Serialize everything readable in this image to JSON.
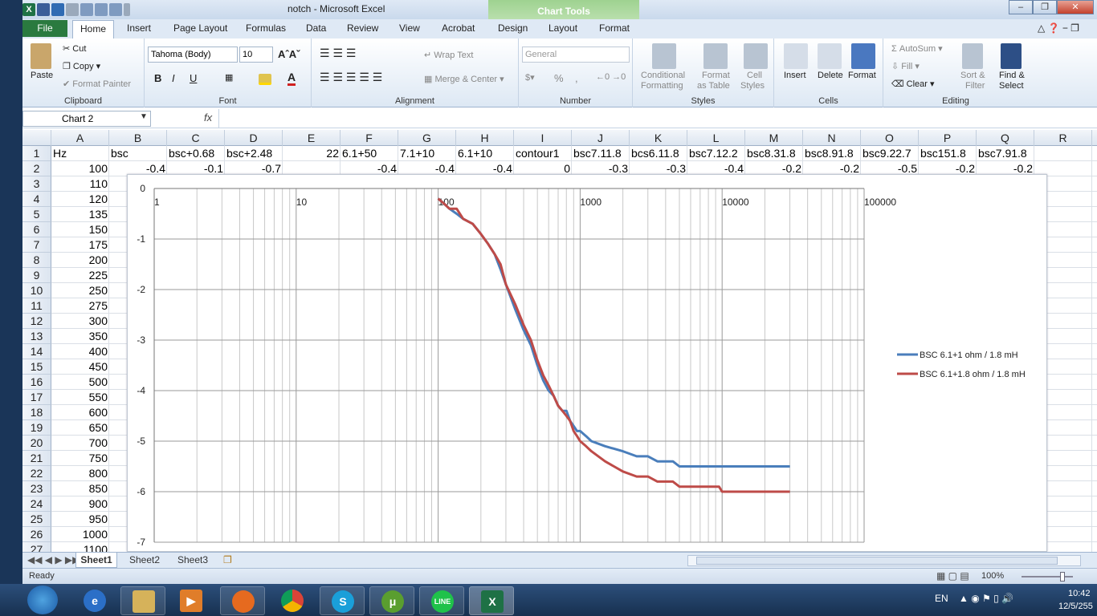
{
  "window": {
    "title": "notch  -  Microsoft Excel",
    "chart_tools": "Chart Tools"
  },
  "tabs": [
    "File",
    "Home",
    "Insert",
    "Page Layout",
    "Formulas",
    "Data",
    "Review",
    "View",
    "Acrobat",
    "Design",
    "Layout",
    "Format"
  ],
  "clipboard": {
    "label": "Clipboard",
    "paste": "Paste",
    "cut": "Cut",
    "copy": "Copy",
    "painter": "Format Painter"
  },
  "font": {
    "label": "Font",
    "family": "Tahoma (Body)",
    "size": "10",
    "bold": "B",
    "italic": "I",
    "underline": "U"
  },
  "alignment": {
    "label": "Alignment",
    "wrap": "Wrap Text",
    "merge": "Merge & Center"
  },
  "number": {
    "label": "Number",
    "format": "General",
    "percent": "%",
    "comma": ","
  },
  "styles": {
    "label": "Styles",
    "cond1": "Conditional",
    "cond2": "Formatting",
    "fmt1": "Format",
    "fmt2": "as Table",
    "cell1": "Cell",
    "cell2": "Styles"
  },
  "cells": {
    "label": "Cells",
    "insert": "Insert",
    "delete": "Delete",
    "format": "Format"
  },
  "editing": {
    "label": "Editing",
    "autosum": "AutoSum",
    "fill": "Fill",
    "clear": "Clear",
    "sort1": "Sort &",
    "sort2": "Filter",
    "find1": "Find &",
    "find2": "Select"
  },
  "namebox": "Chart 2",
  "fx": "fx",
  "columns": [
    "A",
    "B",
    "C",
    "D",
    "E",
    "F",
    "G",
    "H",
    "I",
    "J",
    "K",
    "L",
    "M",
    "N",
    "O",
    "P",
    "Q",
    "R"
  ],
  "rows": [
    "1",
    "2",
    "3",
    "4",
    "5",
    "6",
    "7",
    "8",
    "9",
    "10",
    "11",
    "12",
    "13",
    "14",
    "15",
    "16",
    "17",
    "18",
    "19",
    "20",
    "21",
    "22",
    "23",
    "24",
    "25",
    "26",
    "27"
  ],
  "row1": [
    "Hz",
    "bsc",
    "bsc+0.68",
    "bsc+2.48",
    "22",
    "6.1+50",
    "7.1+10",
    "6.1+10",
    "contour1",
    "bsc7.11.8",
    "bcs6.11.8",
    "bsc7.12.2",
    "bsc8.31.8",
    "bsc8.91.8",
    "bsc9.22.7",
    "bsc151.8",
    "bsc7.91.8"
  ],
  "row2": [
    "100",
    "-0.4",
    "-0.1",
    "-0.7",
    "",
    "-0.4",
    "-0.4",
    "-0.4",
    "0",
    "-0.3",
    "-0.3",
    "-0.4",
    "-0.2",
    "-0.2",
    "-0.5",
    "-0.2",
    "-0.2"
  ],
  "colA": [
    "110",
    "120",
    "135",
    "150",
    "175",
    "200",
    "225",
    "250",
    "275",
    "300",
    "350",
    "400",
    "450",
    "500",
    "550",
    "600",
    "650",
    "700",
    "750",
    "800",
    "850",
    "900",
    "950",
    "1000",
    "1100"
  ],
  "sheets": [
    "Sheet1",
    "Sheet2",
    "Sheet3"
  ],
  "status": {
    "ready": "Ready",
    "zoom": "100%"
  },
  "taskbar": {
    "lang": "EN",
    "time": "10:42",
    "date": "12/5/255"
  },
  "chart_data": {
    "type": "line",
    "x_scale": "log",
    "xlim": [
      1,
      100000
    ],
    "ylim": [
      -7,
      0
    ],
    "x_ticks": [
      "1",
      "10",
      "100",
      "1000",
      "10000",
      "100000"
    ],
    "y_ticks": [
      "0",
      "-1",
      "-2",
      "-3",
      "-4",
      "-5",
      "-6",
      "-7"
    ],
    "legend": "right",
    "series": [
      {
        "name": "BSC 6.1+1 ohm / 1.8 mH",
        "color": "#4a7ebb",
        "x": [
          100,
          110,
          120,
          135,
          150,
          175,
          200,
          225,
          250,
          275,
          300,
          350,
          400,
          450,
          500,
          550,
          600,
          650,
          700,
          750,
          800,
          850,
          900,
          950,
          1000,
          1100,
          1200,
          1500,
          2000,
          2500,
          3000,
          3500,
          4000,
          4500,
          5000,
          6000,
          8000,
          10000,
          15000,
          20000,
          30000
        ],
        "y": [
          -0.2,
          -0.3,
          -0.4,
          -0.5,
          -0.6,
          -0.7,
          -0.9,
          -1.1,
          -1.3,
          -1.6,
          -1.9,
          -2.4,
          -2.8,
          -3.1,
          -3.5,
          -3.8,
          -4.0,
          -4.1,
          -4.3,
          -4.4,
          -4.4,
          -4.6,
          -4.7,
          -4.8,
          -4.8,
          -4.9,
          -5.0,
          -5.1,
          -5.2,
          -5.3,
          -5.3,
          -5.4,
          -5.4,
          -5.4,
          -5.5,
          -5.5,
          -5.5,
          -5.5,
          -5.5,
          -5.5,
          -5.5
        ]
      },
      {
        "name": "BSC 6.1+1.8 ohm / 1.8 mH",
        "color": "#be4b48",
        "x": [
          100,
          110,
          120,
          135,
          150,
          175,
          200,
          225,
          250,
          275,
          300,
          350,
          400,
          450,
          500,
          550,
          600,
          650,
          700,
          750,
          800,
          850,
          900,
          950,
          1000,
          1100,
          1200,
          1500,
          2000,
          2500,
          3000,
          3500,
          4000,
          4500,
          5000,
          6000,
          8000,
          9500,
          10000,
          15000,
          20000,
          30000
        ],
        "y": [
          -0.2,
          -0.3,
          -0.4,
          -0.4,
          -0.6,
          -0.7,
          -0.9,
          -1.1,
          -1.3,
          -1.5,
          -1.9,
          -2.3,
          -2.7,
          -3.0,
          -3.4,
          -3.7,
          -3.9,
          -4.1,
          -4.3,
          -4.4,
          -4.5,
          -4.6,
          -4.8,
          -4.9,
          -5.0,
          -5.1,
          -5.2,
          -5.4,
          -5.6,
          -5.7,
          -5.7,
          -5.8,
          -5.8,
          -5.8,
          -5.9,
          -5.9,
          -5.9,
          -5.9,
          -6.0,
          -6.0,
          -6.0,
          -6.0
        ]
      }
    ]
  }
}
